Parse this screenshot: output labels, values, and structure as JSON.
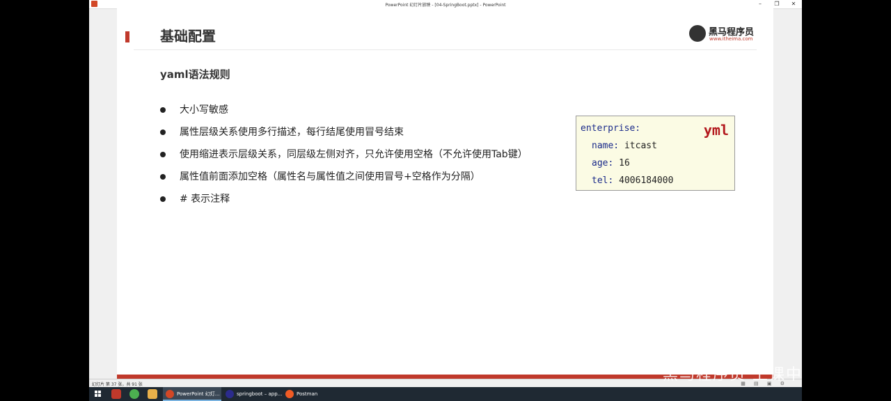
{
  "window": {
    "title": "PowerPoint 幻灯片放映 - [04-SpringBoot.pptx] - PowerPoint",
    "controls": [
      "–",
      "❐",
      "✕"
    ]
  },
  "slide": {
    "title": "基础配置",
    "logo": {
      "name": "黑马程序员",
      "url": "www.itheima.com"
    },
    "subtitle": "yaml语法规则",
    "bullets": [
      "大小写敏感",
      "属性层级关系使用多行描述，每行结尾使用冒号结束",
      "使用缩进表示层级关系，同层级左侧对齐，只允许使用空格（不允许使用Tab键）",
      "属性值前面添加空格（属性名与属性值之间使用冒号+空格作为分隔）",
      "# 表示注释"
    ],
    "code": {
      "tag": "yml",
      "lines": [
        {
          "key": "enterprise:",
          "value": ""
        },
        {
          "key": "name:",
          "value": " itcast"
        },
        {
          "key": "age:",
          "value": " 16"
        },
        {
          "key": "tel:",
          "value": " 4006184000"
        }
      ]
    },
    "accent_color": "#c0392b"
  },
  "statusbar": {
    "text": "幻灯片 第 37 张，共 91 张",
    "icons": [
      "slide-sorter-icon",
      "reading-view-icon",
      "notes-icon",
      "settings-icon"
    ]
  },
  "taskbar": {
    "items": [
      {
        "label": "PowerPoint 幻灯...",
        "icon": "powerpoint-icon",
        "color": "#d24726",
        "active": true
      },
      {
        "label": "springboot – app...",
        "icon": "intellij-icon",
        "color": "#2b2b8c",
        "active": false
      },
      {
        "label": "Postman",
        "icon": "postman-icon",
        "color": "#ef5b25",
        "active": false
      }
    ]
  },
  "watermark": "黑马程序员 上课中"
}
